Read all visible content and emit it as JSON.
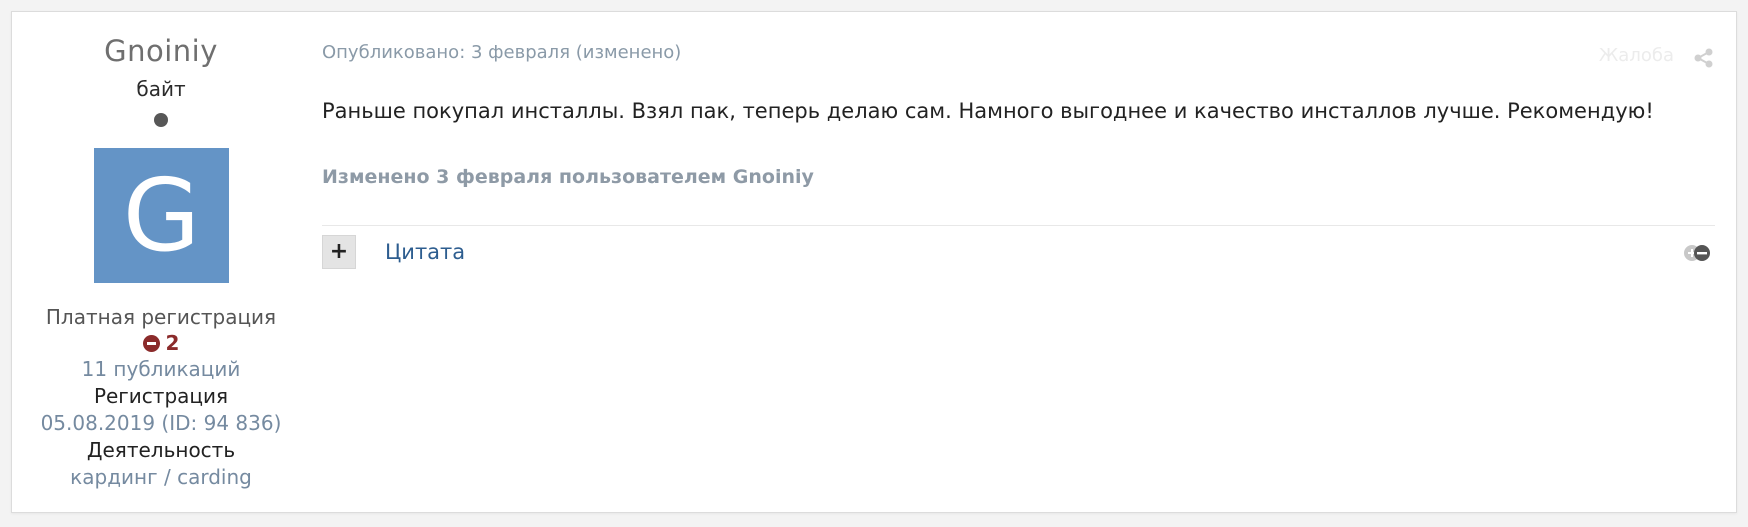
{
  "author": {
    "name": "Gnoiniy",
    "rank": "байт",
    "avatar_letter": "G",
    "avatar_color": "#6494c6",
    "online_status_color": "#575757",
    "group": "Платная регистрация",
    "reputation": "2",
    "reputation_color": "#8b2b2b",
    "posts": "11 публикаций",
    "registration_label": "Регистрация",
    "registration_value": "05.08.2019 (ID: 94 836)",
    "activity_label": "Деятельность",
    "activity_value": "кардинг / carding"
  },
  "post": {
    "published": "Опубликовано: 3 февраля (изменено)",
    "report_label": "Жалоба",
    "share_icon": "share-icon",
    "body": "Раньше покупал инсталлы. Взял пак, теперь делаю сам. Намного выгоднее и качество инсталлов лучше. Рекомендую!",
    "edited_note": "Изменено 3 февраля пользователем Gnoiniy",
    "multiquote_label": "+",
    "quote_label": "Цитата",
    "reaction_icon": "reaction-icon"
  }
}
